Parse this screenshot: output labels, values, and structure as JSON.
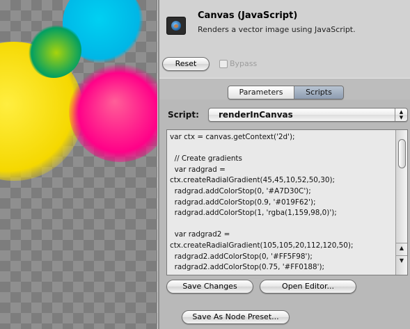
{
  "inspector": {
    "title": "Canvas (JavaScript)",
    "subtitle": "Renders a vector image using JavaScript.",
    "icon": "portrait-icon",
    "reset_label": "Reset",
    "bypass_label": "Bypass",
    "bypass_checked": false,
    "tabs": [
      {
        "label": "Parameters",
        "active": false
      },
      {
        "label": "Scripts",
        "active": true
      }
    ],
    "script_label": "Script:",
    "script_selected": "renderInCanvas",
    "code": "var ctx = canvas.getContext('2d');\n\n  // Create gradients\n  var radgrad =\nctx.createRadialGradient(45,45,10,52,50,30);\n  radgrad.addColorStop(0, '#A7D30C');\n  radgrad.addColorStop(0.9, '#019F62');\n  radgrad.addColorStop(1, 'rgba(1,159,98,0)');\n\n  var radgrad2 =\nctx.createRadialGradient(105,105,20,112,120,50);\n  radgrad2.addColorStop(0, '#FF5F98');\n  radgrad2.addColorStop(0.75, '#FF0188');",
    "save_changes_label": "Save Changes",
    "open_editor_label": "Open Editor...",
    "save_preset_label": "Save As Node Preset..."
  },
  "colors": {
    "green_inner": "#A7D30C",
    "green_outer": "#019F62",
    "pink_inner": "#FF5F98",
    "pink_outer": "#FF0188",
    "cyan": "#00C6EE",
    "yellow": "#FFE000"
  }
}
